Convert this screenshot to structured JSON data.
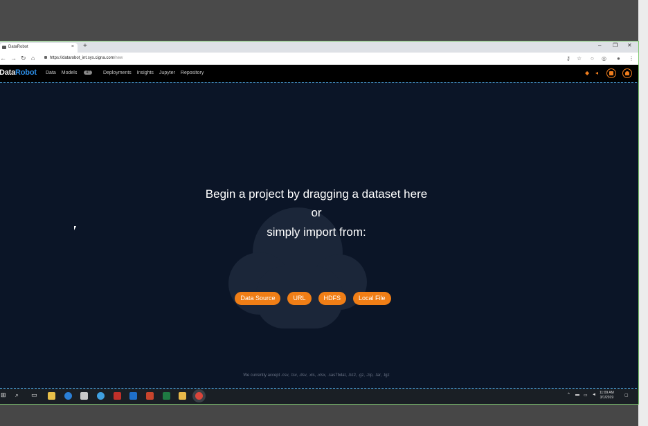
{
  "browser": {
    "tab_title": "DataRobot",
    "tab_close": "×",
    "new_tab": "+",
    "url_host": "https://datarobot_int.sys.cigna.com",
    "url_path": "/new",
    "window_controls": {
      "minimize": "–",
      "restore": "❐",
      "close": "✕"
    }
  },
  "app": {
    "logo_data": "Data",
    "logo_robot": "Robot",
    "nav": [
      {
        "label": "Data"
      },
      {
        "label": "Models",
        "badge": "47"
      },
      {
        "label": "Deployments"
      },
      {
        "label": "Insights"
      },
      {
        "label": "Jupyter"
      },
      {
        "label": "Repository"
      }
    ]
  },
  "dropzone": {
    "line1": "Begin a project by dragging a dataset here",
    "line2": "or",
    "line3": "simply import from:",
    "buttons": [
      "Data Source",
      "URL",
      "HDFS",
      "Local File"
    ],
    "accepted_formats": "We currently accept .csv, .tsv, .dsv, .xls, .xlsx, .sas7bdat, .bz2, .gz, .zip, .tar, .tgz"
  },
  "taskbar": {
    "clock_time": "11:09 AM",
    "clock_date": "3/1/2019"
  },
  "colors": {
    "accent": "#f07e16",
    "background": "#0b1527",
    "logo_blue": "#2d8fe8"
  }
}
